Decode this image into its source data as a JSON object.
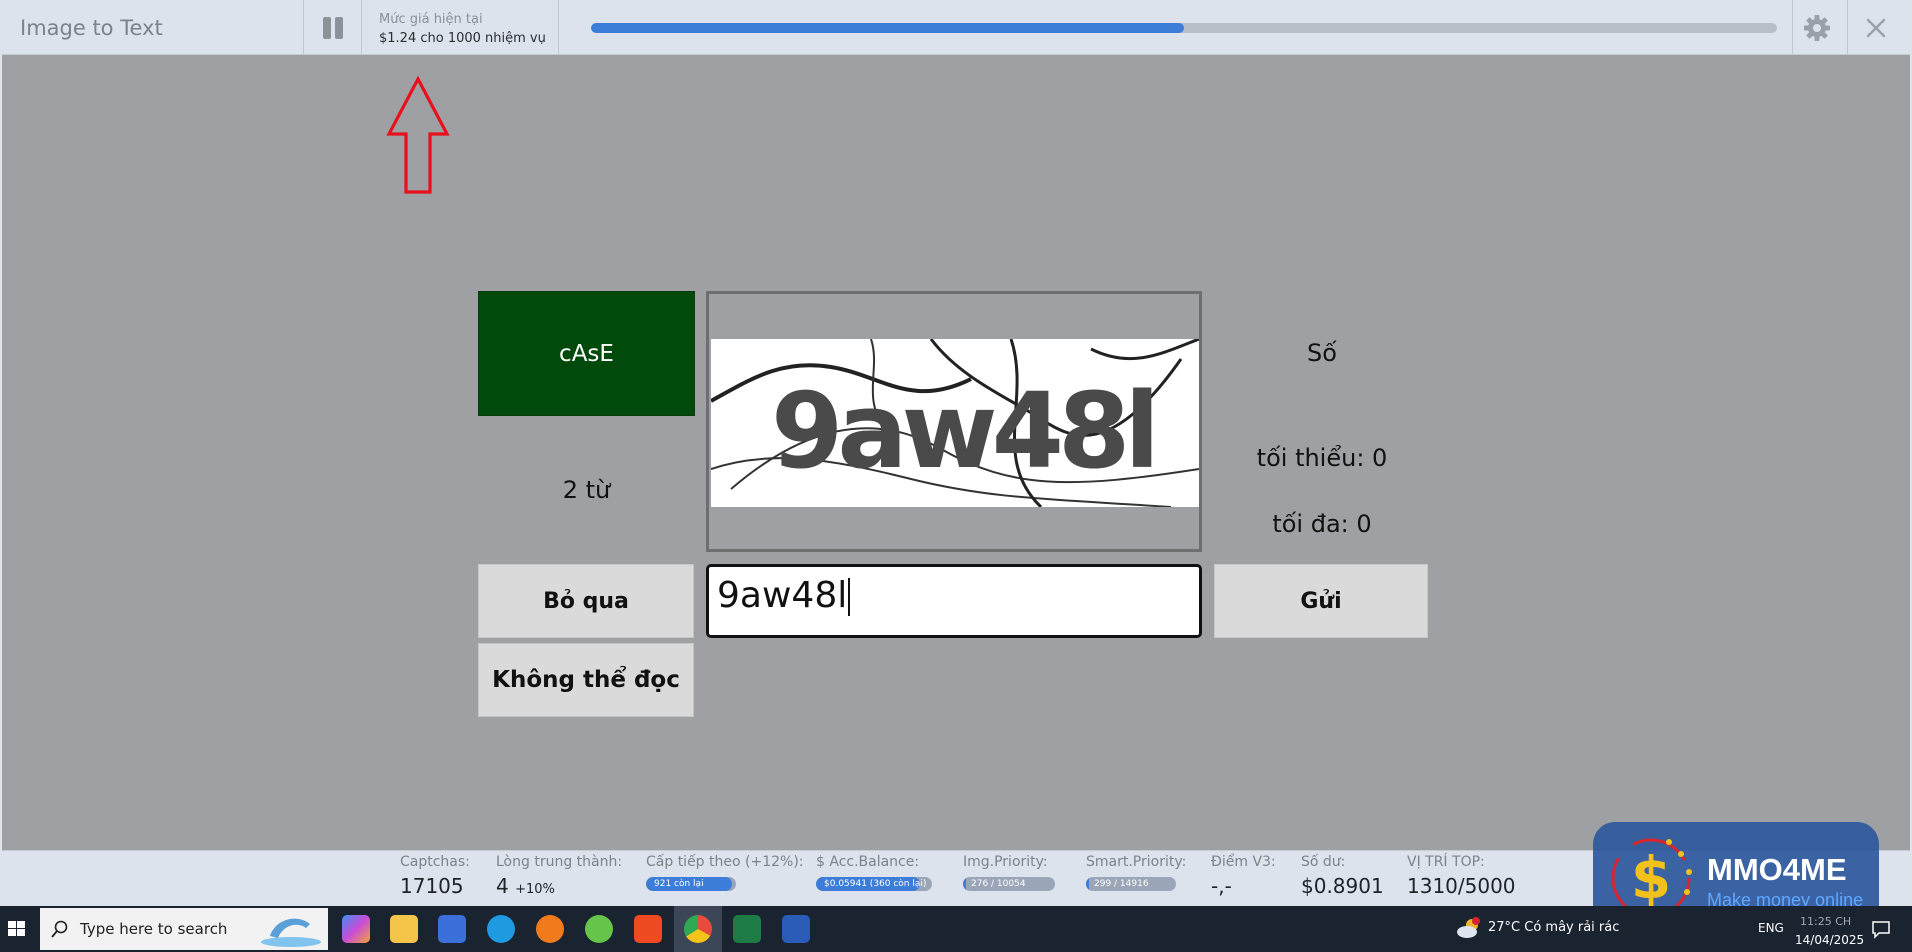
{
  "window": {
    "title": "Image to Text",
    "price_label": "Mức giá hiện tại",
    "price_value": "$1.24 cho 1000 nhiệm vụ",
    "task_progress_fraction": 0.5
  },
  "captcha": {
    "case_label": "cAsE",
    "word_count": "2 từ",
    "image_text": "9aw48l",
    "type_hint": "Số",
    "min_hint": "tối thiểu: 0",
    "max_hint": "tối đa: 0",
    "answer_value": "9aw48l"
  },
  "buttons": {
    "skip": "Bỏ qua",
    "unreadable": "Không thể đọc",
    "send": "Gửi"
  },
  "stats": {
    "captchas": {
      "label": "Captchas:",
      "value": "17105"
    },
    "loyalty": {
      "label": "Lòng trung thành:",
      "value": "4",
      "bonus": "+10%"
    },
    "next_level": {
      "label": "Cấp tiếp theo (+12%):",
      "bar_text": "921 còn lại",
      "fill": 0.95
    },
    "acc_balance": {
      "label": "$ Acc.Balance:",
      "bar_text": "$0.05941 (360 còn lại)",
      "fill": 0.9
    },
    "img_priority": {
      "label": "Img.Priority:",
      "bar_text": "276 / 10054",
      "fill": 0.03
    },
    "smart_priority": {
      "label": "Smart.Priority:",
      "bar_text": "299 / 14916",
      "fill": 0.03
    },
    "v3_score": {
      "label": "Điểm V3:",
      "value": "-,-"
    },
    "balance": {
      "label": "Số dư:",
      "value": "$0.8901"
    },
    "top_rank": {
      "label": "VỊ TRÍ TOP:",
      "value": "1310/5000"
    }
  },
  "watermark": {
    "title": "MMO4ME",
    "subtitle": "Make money online"
  },
  "taskbar": {
    "search_placeholder": "Type here to search",
    "weather": "27°C  Có mây rải rác",
    "language": "ENG",
    "time": "11:25 CH",
    "date": "14/04/2025"
  },
  "colors": {
    "accent": "#3b7dd8",
    "case_box": "#014a0c",
    "annotation_arrow": "#e8101a"
  }
}
